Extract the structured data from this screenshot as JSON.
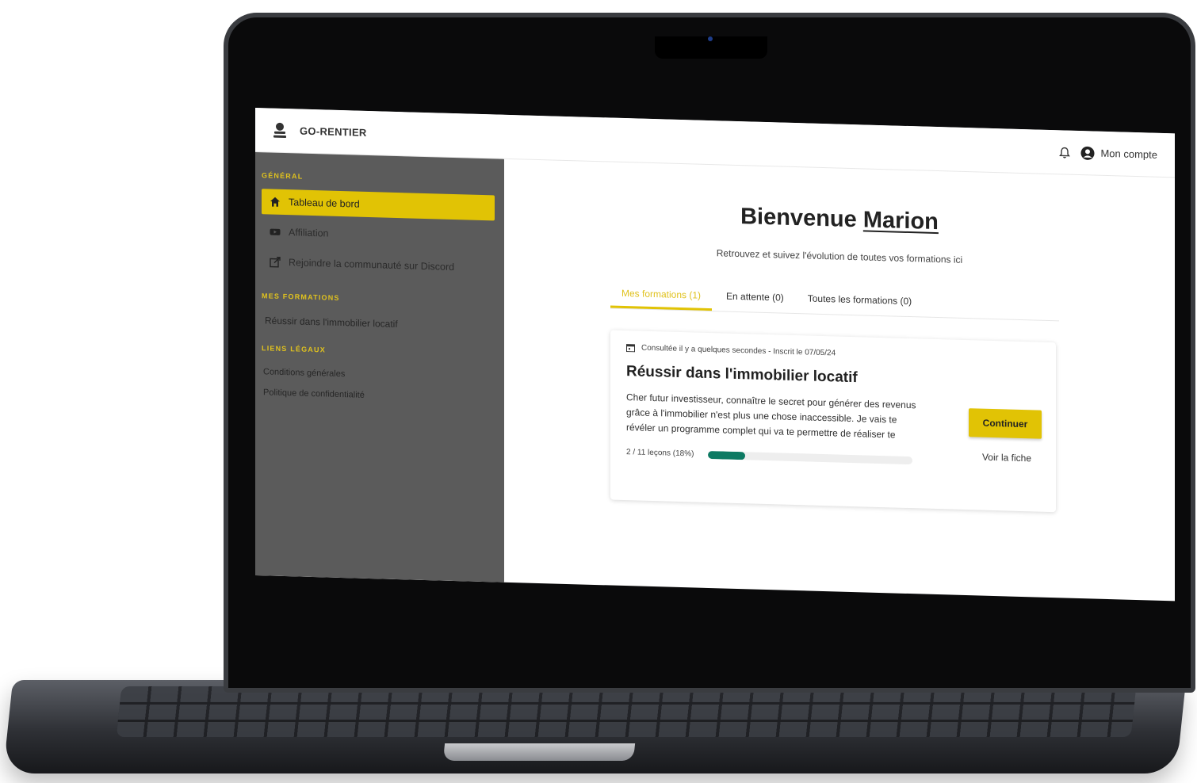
{
  "app": {
    "brand": "GO-RENTIER"
  },
  "topbar": {
    "account_label": "Mon compte"
  },
  "sidebar": {
    "general_title": "GÉNÉRAL",
    "general_items": [
      {
        "label": "Tableau de bord",
        "icon": "home-icon",
        "active": true
      },
      {
        "label": "Affiliation",
        "icon": "video-icon"
      },
      {
        "label": "Rejoindre la communauté sur Discord",
        "icon": "external-link-icon"
      }
    ],
    "formations_title": "MES FORMATIONS",
    "formations_items": [
      "Réussir dans l'immobilier locatif"
    ],
    "legal_title": "LIENS LÉGAUX",
    "legal_items": [
      "Conditions générales",
      "Politique de confidentialité"
    ]
  },
  "main": {
    "welcome_prefix": "Bienvenue",
    "user_name": "Marion",
    "subtitle": "Retrouvez et suivez l'évolution de toutes vos formations ici",
    "tabs": [
      {
        "label": "Mes formations (1)",
        "active": true
      },
      {
        "label": "En attente (0)"
      },
      {
        "label": "Toutes les formations (0)"
      }
    ],
    "course": {
      "meta": "Consultée il y a quelques secondes - Inscrit le 07/05/24",
      "title": "Réussir dans l'immobilier locatif",
      "description": "Cher futur investisseur, connaître le secret pour générer des revenus grâce à l'immobilier n'est plus une chose inaccessible. Je vais te révéler un programme complet qui va te permettre de réaliser te",
      "progress_label": "2 / 11 leçons (18%)",
      "progress_fraction": 0.18,
      "continue_label": "Continuer",
      "view_label": "Voir la fiche"
    }
  },
  "colors": {
    "accent": "#e1c305",
    "sidebar": "#5b5b5b",
    "progress": "#0d7a63"
  }
}
